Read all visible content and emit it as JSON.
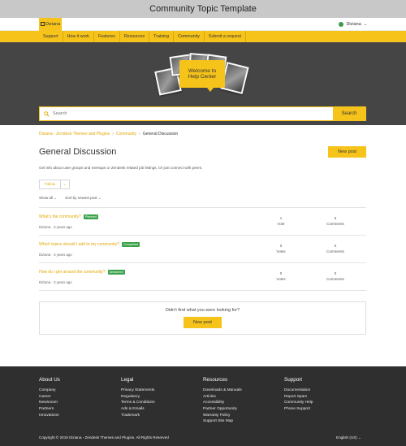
{
  "window": {
    "title": "Community Topic Template"
  },
  "brand": {
    "name": "Diziana",
    "accent": "#f6c31b",
    "hero_bg": "#454545",
    "footer_bg": "#2f2f2f",
    "badge_green": "#3aa34a"
  },
  "user": {
    "name": "Diziana"
  },
  "nav": [
    {
      "label": "Support"
    },
    {
      "label": "How it work"
    },
    {
      "label": "Features"
    },
    {
      "label": "Resources"
    },
    {
      "label": "Training"
    },
    {
      "label": "Community"
    },
    {
      "label": "Submit a request"
    }
  ],
  "hero": {
    "welcome_line1": "Welcome to",
    "welcome_line2": "Help Center"
  },
  "search": {
    "placeholder": "Search",
    "button": "Search"
  },
  "breadcrumbs": [
    "Diziana - Zendesk Themes and Plugins",
    "Community",
    "General Discussion"
  ],
  "topic": {
    "title": "General Discussion",
    "new_post_label": "New post",
    "description": "Get info about user groups and meetups or Zendesk related job listings. Or just connect with peers.",
    "follow_label": "Follow",
    "show_filter": "Show all",
    "sort_filter": "Sort by newest post"
  },
  "posts": [
    {
      "title": "What's the community?",
      "badge": "Planned",
      "author": "Diziana",
      "age": "3 years ago",
      "votes": "1",
      "votes_label": "Vote",
      "comments": "6",
      "comments_label": "Comments"
    },
    {
      "title": "Which topics should I add to my community?",
      "badge": "Completed",
      "author": "Diziana",
      "age": "3 years ago",
      "votes": "0",
      "votes_label": "Votes",
      "comments": "0",
      "comments_label": "Comments"
    },
    {
      "title": "How do I get around the community?",
      "badge": "Answered",
      "author": "Diziana",
      "age": "3 years ago",
      "votes": "0",
      "votes_label": "Votes",
      "comments": "0",
      "comments_label": "Comments"
    }
  ],
  "not_found": {
    "text": "Didn't find what you were looking for?",
    "button": "New post"
  },
  "footer": {
    "columns": [
      {
        "heading": "About Us",
        "links": [
          "Company",
          "Career",
          "Newsroom",
          "Partners",
          "Innovations"
        ]
      },
      {
        "heading": "Legal",
        "links": [
          "Privacy Statements",
          "Regulatory",
          "Terms & Conditions",
          "Ads & Emails",
          "Trademark"
        ]
      },
      {
        "heading": "Resources",
        "links": [
          "Downloads & Manuals",
          "Articles",
          "Accessibility",
          "Partner Opportunity",
          "Warranty Policy",
          "Support Site Map"
        ]
      },
      {
        "heading": "Support",
        "links": [
          "Documentation",
          "Report Spam",
          "Community Help",
          "Phone Support"
        ]
      }
    ],
    "copyright": "Copyright © 2019 Diziana - Zendesk Themes and Plugins. All Rights Reserved",
    "language": "English (US)"
  }
}
